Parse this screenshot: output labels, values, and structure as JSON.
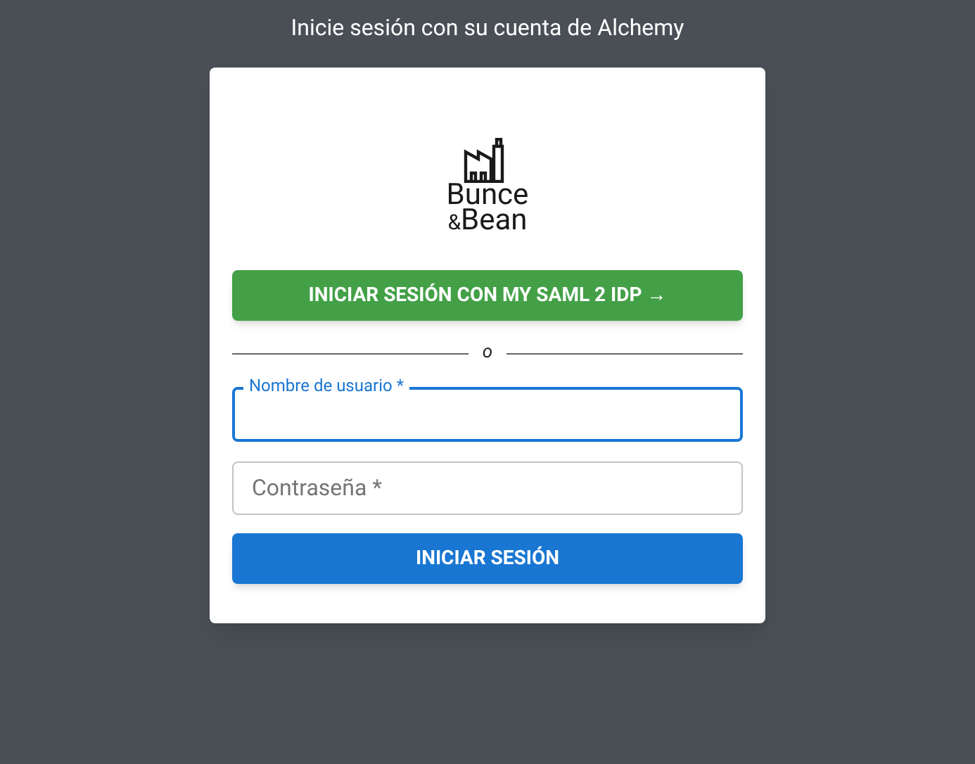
{
  "heading": "Inicie sesión con su cuenta de Alchemy",
  "logo": {
    "line_1": "Bunce",
    "line_2_prefix": "&",
    "line_2": "Bean"
  },
  "sso_button": "INICIAR SESIÓN CON MY SAML 2 IDP →",
  "divider": "o",
  "fields": [
    {
      "placeholder": "Nombre de usuario *",
      "focused": true
    },
    {
      "placeholder": "Contraseña *",
      "focused": false
    }
  ],
  "submit_button": "INICIAR SESIÓN"
}
